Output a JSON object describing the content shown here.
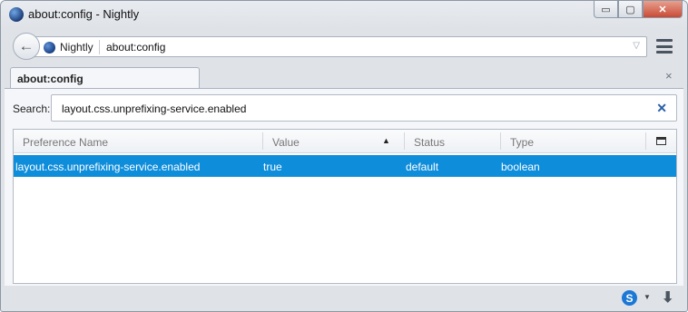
{
  "window": {
    "title": "about:config - Nightly"
  },
  "caption": {
    "minimize": "▭",
    "maximize": "▢",
    "close": "✕"
  },
  "navbar": {
    "back_icon": "←",
    "identity_label": "Nightly",
    "url": "about:config",
    "dropdown_icon": "▽"
  },
  "tabs": [
    {
      "label": "about:config"
    }
  ],
  "tab_close_icon": "×",
  "search": {
    "label": "Search:",
    "value": "layout.css.unprefixing-service.enabled",
    "clear_icon": "✕"
  },
  "table": {
    "columns": [
      "Preference Name",
      "Value",
      "Status",
      "Type"
    ],
    "sort_indicator": "▲",
    "rows": [
      {
        "name": "layout.css.unprefixing-service.enabled",
        "value": "true",
        "status": "default",
        "type": "boolean"
      }
    ]
  },
  "statusbar": {
    "skype_label": "S",
    "skype_drop": "▼",
    "download_icon": "⬇"
  },
  "colors": {
    "selection": "#0e8ddb",
    "close_button": "#c74b36"
  }
}
